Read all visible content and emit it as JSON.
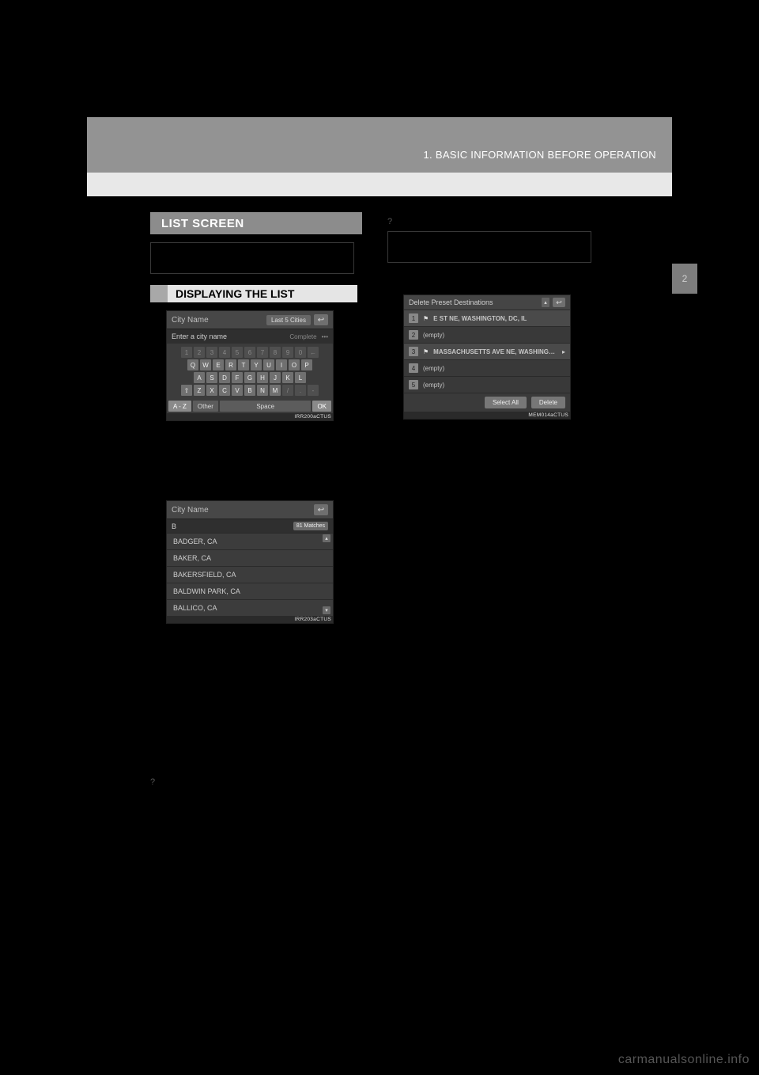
{
  "header": {
    "breadcrumb": "1. BASIC INFORMATION BEFORE OPERATION"
  },
  "side_tab": "2",
  "left": {
    "section_title": "LIST SCREEN",
    "sub_heading": "DISPLAYING THE LIST",
    "keyboard_panel": {
      "title": "City Name",
      "last5": "Last 5 Cities",
      "placeholder": "Enter a city name",
      "complete": "Complete",
      "dots": "•••",
      "row_num": [
        "1",
        "2",
        "3",
        "4",
        "5",
        "6",
        "7",
        "8",
        "9",
        "0",
        "←"
      ],
      "row_q": [
        "Q",
        "W",
        "E",
        "R",
        "T",
        "Y",
        "U",
        "I",
        "O",
        "P"
      ],
      "row_a": [
        "A",
        "S",
        "D",
        "F",
        "G",
        "H",
        "J",
        "K",
        "L"
      ],
      "row_z": [
        "⇧",
        "Z",
        "X",
        "C",
        "V",
        "B",
        "N",
        "M",
        "/",
        ".",
        "-"
      ],
      "bottom": {
        "az": "A - Z",
        "other": "Other",
        "space": "Space",
        "ok": "OK"
      },
      "footer_id": "IRR200aCTUS"
    },
    "results_panel": {
      "title": "City Name",
      "query": "B",
      "matches": "81 Matches",
      "rows": [
        "BADGER, CA",
        "BAKER, CA",
        "BAKERSFIELD, CA",
        "BALDWIN PARK, CA",
        "BALLICO, CA"
      ],
      "footer_id": "IRR203aCTUS"
    }
  },
  "right": {
    "preset_panel": {
      "title": "Delete Preset Destinations",
      "rows": [
        {
          "idx": "1",
          "label": "E ST NE, WASHINGTON, DC, IL",
          "flagged": true
        },
        {
          "idx": "2",
          "label": "(empty)",
          "flagged": false
        },
        {
          "idx": "3",
          "label": "MASSACHUSETTS AVE NE, WASHINGTON,",
          "flagged": true,
          "truncated": true
        },
        {
          "idx": "4",
          "label": "(empty)",
          "flagged": false
        },
        {
          "idx": "5",
          "label": "(empty)",
          "flagged": false
        }
      ],
      "select_all": "Select All",
      "delete": "Delete",
      "footer_id": "MEM014aCTUS"
    }
  },
  "icons": {
    "back": "↩",
    "up": "▴",
    "down": "▾",
    "flag": "⚑",
    "right": "▸",
    "bullet": "?"
  },
  "watermark": "carmanualsonline.info"
}
